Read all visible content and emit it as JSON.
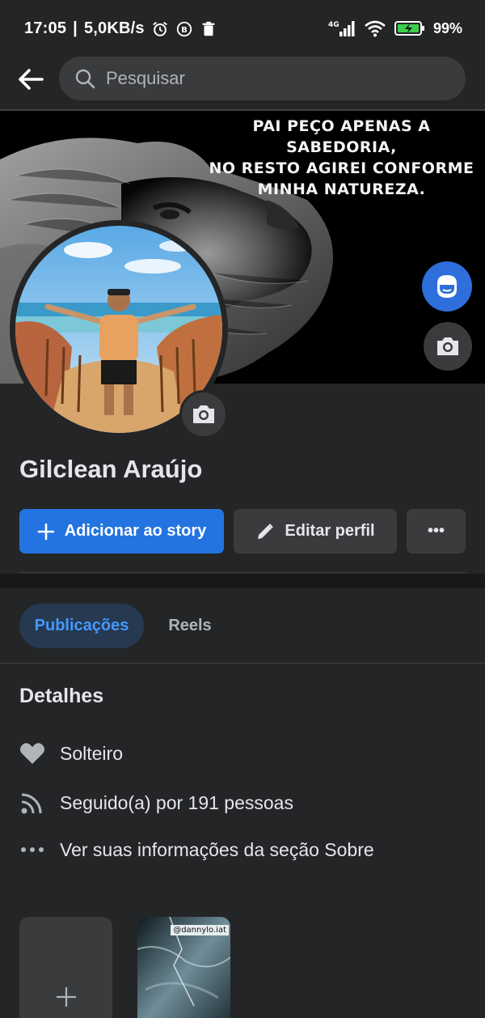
{
  "status_bar": {
    "time": "17:05",
    "speed": "5,0KB/s",
    "network": "4G",
    "battery": "99%"
  },
  "search": {
    "placeholder": "Pesquisar"
  },
  "cover": {
    "quote_lines": [
      "PAI PEÇO APENAS A SABEDORIA,",
      "NO RESTO AGIREI CONFORME",
      "MINHA NATUREZA."
    ]
  },
  "profile": {
    "name": "Gilclean Araújo"
  },
  "actions": {
    "add_story": "Adicionar ao story",
    "edit_profile": "Editar perfil",
    "more": "•••"
  },
  "tabs": [
    {
      "label": "Publicações",
      "active": true
    },
    {
      "label": "Reels",
      "active": false
    }
  ],
  "details": {
    "title": "Detalhes",
    "items": [
      {
        "icon": "heart-icon",
        "text": "Solteiro"
      },
      {
        "icon": "rss-icon",
        "text": "Seguido(a) por 191 pessoas"
      },
      {
        "icon": "more-dots-icon",
        "text": "Ver suas informações da seção Sobre"
      }
    ]
  },
  "cards": {
    "photo_tag": "@dannylo.iat"
  },
  "colors": {
    "background": "#242526",
    "accent": "#2374e1",
    "tab_active_bg": "#263951",
    "tab_active_text": "#4599ff"
  }
}
